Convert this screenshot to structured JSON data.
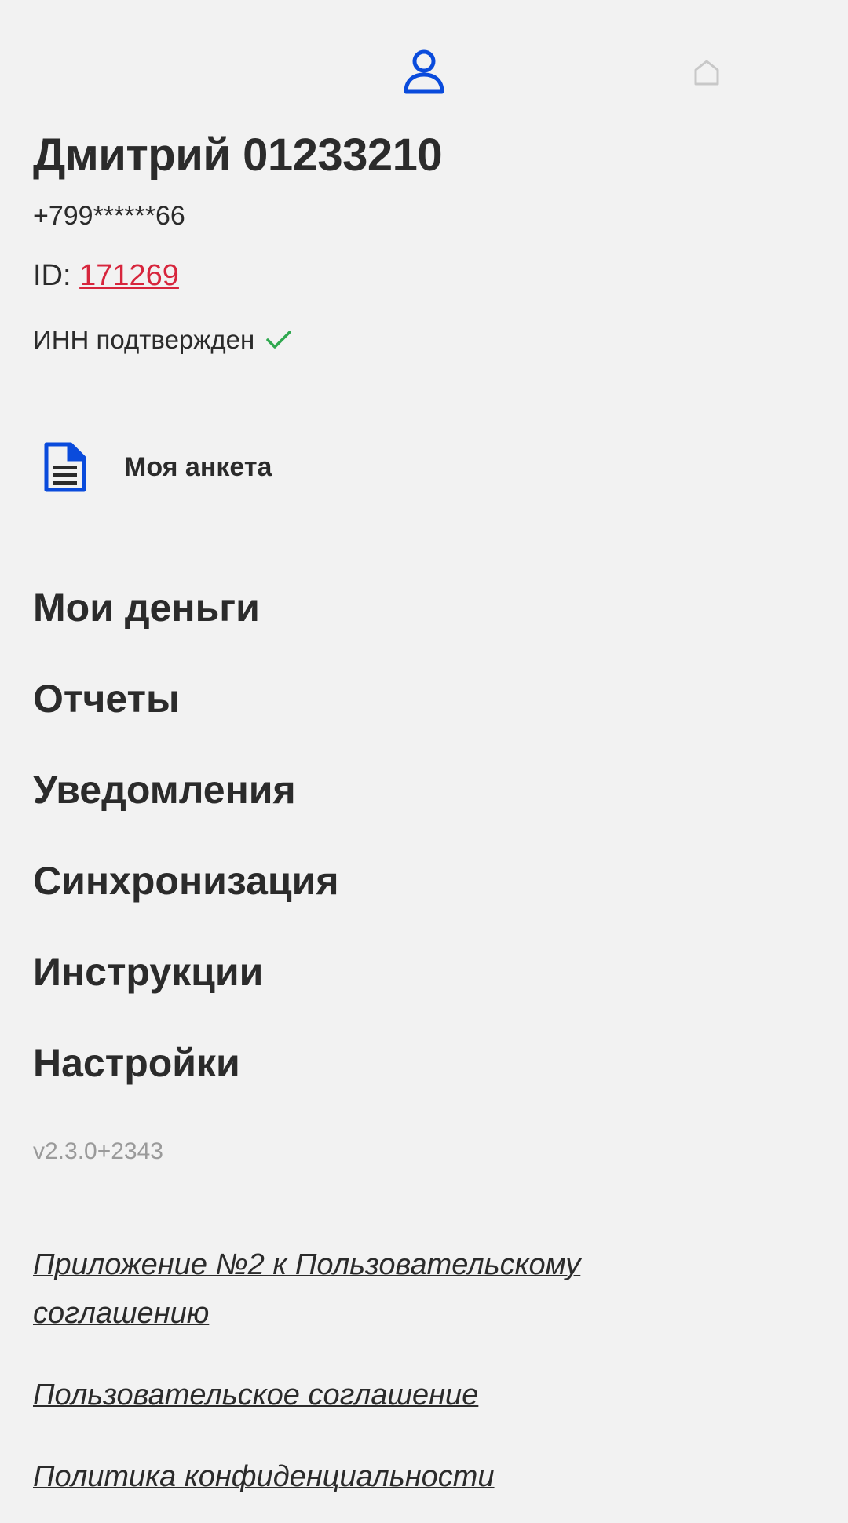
{
  "topbar": {
    "profile_icon": "user-icon",
    "home_icon": "home-icon",
    "accent": "#0a4bdc"
  },
  "profile": {
    "name": "Дмитрий 01233210",
    "phone": "+799******66",
    "id_label": "ID: ",
    "id_value": "171269",
    "inn_status": "ИНН подтвержден",
    "inn_check_icon": "check-icon"
  },
  "anketa": {
    "icon": "document-icon",
    "label": "Моя анкета"
  },
  "menu": {
    "items": [
      {
        "label": "Мои деньги"
      },
      {
        "label": "Отчеты"
      },
      {
        "label": "Уведомления"
      },
      {
        "label": "Синхронизация"
      },
      {
        "label": "Инструкции"
      },
      {
        "label": "Настройки"
      }
    ]
  },
  "version": "v2.3.0+2343",
  "legal": {
    "appendix": "Приложение №2 к Пользовательскому соглашению",
    "agreement": "Пользовательское соглашение",
    "privacy": "Политика конфиденциальности"
  },
  "colors": {
    "background": "#f2f2f2",
    "text": "#2b2b2b",
    "link_red": "#d7263d",
    "check_green": "#2fa84f",
    "muted": "#9a9a9a"
  }
}
